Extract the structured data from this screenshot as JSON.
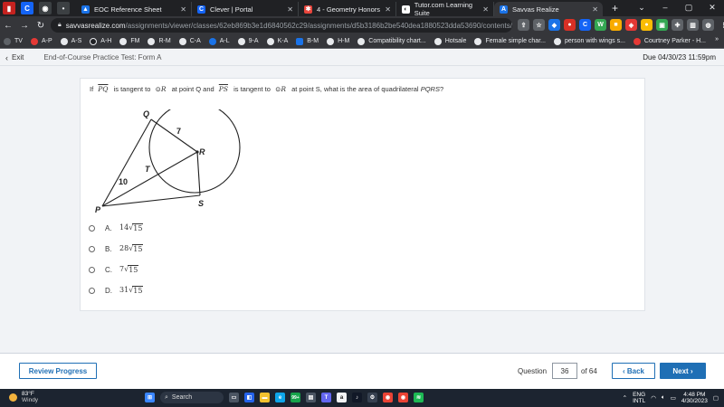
{
  "browser": {
    "tabs": [
      {
        "label": "EOC Reference Sheet",
        "favicon": "drive-icon",
        "color": "#1a73e8"
      },
      {
        "label": "Clever | Portal",
        "favicon": "clever-icon",
        "color": "#1464f6"
      },
      {
        "label": "4 - Geometry Honors",
        "favicon": "savvas-icon",
        "color": "#e8453c"
      },
      {
        "label": "Tutor.com Learning Suite",
        "favicon": "tutor-icon",
        "color": "#ffffff"
      },
      {
        "label": "Savvas Realize",
        "favicon": "savvas-icon",
        "color": "#1a73e8"
      }
    ],
    "url_host": "savvasrealize.com",
    "url_path": "/assignments/viewer/classes/62eb869b3e1d6840562c29/assignments/d5b3186b2be540dea1880523dda53690/contents/59..."
  },
  "bookmarks": [
    {
      "label": "TV",
      "color": "#ffffff"
    },
    {
      "label": "A-P",
      "color": "#e53935"
    },
    {
      "label": "A-S",
      "color": "#ffffff"
    },
    {
      "label": "A-H",
      "color": "#ffffff"
    },
    {
      "label": "FM",
      "color": "#ffffff"
    },
    {
      "label": "R-M",
      "color": "#ffffff"
    },
    {
      "label": "C-A",
      "color": "#ffffff"
    },
    {
      "label": "A-L",
      "color": "#1a73e8"
    },
    {
      "label": "9-A",
      "color": "#ffffff"
    },
    {
      "label": "K-A",
      "color": "#ffffff"
    },
    {
      "label": "B-M",
      "color": "#1a73e8"
    },
    {
      "label": "H-M",
      "color": "#ffffff"
    },
    {
      "label": "Compatibility chart...",
      "color": "#ffffff"
    },
    {
      "label": "Hotsale",
      "color": "#ffffff"
    },
    {
      "label": "Female simple char...",
      "color": "#ffffff"
    },
    {
      "label": "person with wings s...",
      "color": "#ffffff"
    },
    {
      "label": "Courtney Parker - H...",
      "color": "#e53935"
    }
  ],
  "header": {
    "exit_label": "Exit",
    "test_title": "End-of-Course Practice Test: Form A",
    "due": "Due 04/30/23 11:59pm"
  },
  "question": {
    "if": "If",
    "pq": "PQ",
    "tangent_q": "is tangent to",
    "circle_symbol": "⊙",
    "r": "R",
    "at_point_q": "at point Q and",
    "ps": "PS",
    "tangent_s": "is tangent to",
    "at_point_s": "at point S, what is the area of quadrilateral",
    "pqrs": "PQRS",
    "qmark": "?",
    "figure_labels": {
      "q": "Q",
      "r": "R",
      "t": "T",
      "s": "S",
      "p": "P",
      "seven": "7",
      "ten": "10"
    },
    "choices": [
      {
        "letter": "A.",
        "coef": "14",
        "radicand": "15"
      },
      {
        "letter": "B.",
        "coef": "28",
        "radicand": "15"
      },
      {
        "letter": "C.",
        "coef": "7",
        "radicand": "15"
      },
      {
        "letter": "D.",
        "coef": "31",
        "radicand": "15"
      }
    ],
    "radical": "√"
  },
  "footer": {
    "review_label": "Review Progress",
    "question_label": "Question",
    "question_number": "36",
    "of_label": "of 64",
    "back_label": "Back",
    "next_label": "Next"
  },
  "taskbar": {
    "temperature": "83°F",
    "condition": "Windy",
    "search_label": "Search",
    "lang_line1": "ENG",
    "lang_line2": "INTL",
    "time": "4:48 PM",
    "date": "4/30/2023",
    "badge": "99+"
  }
}
